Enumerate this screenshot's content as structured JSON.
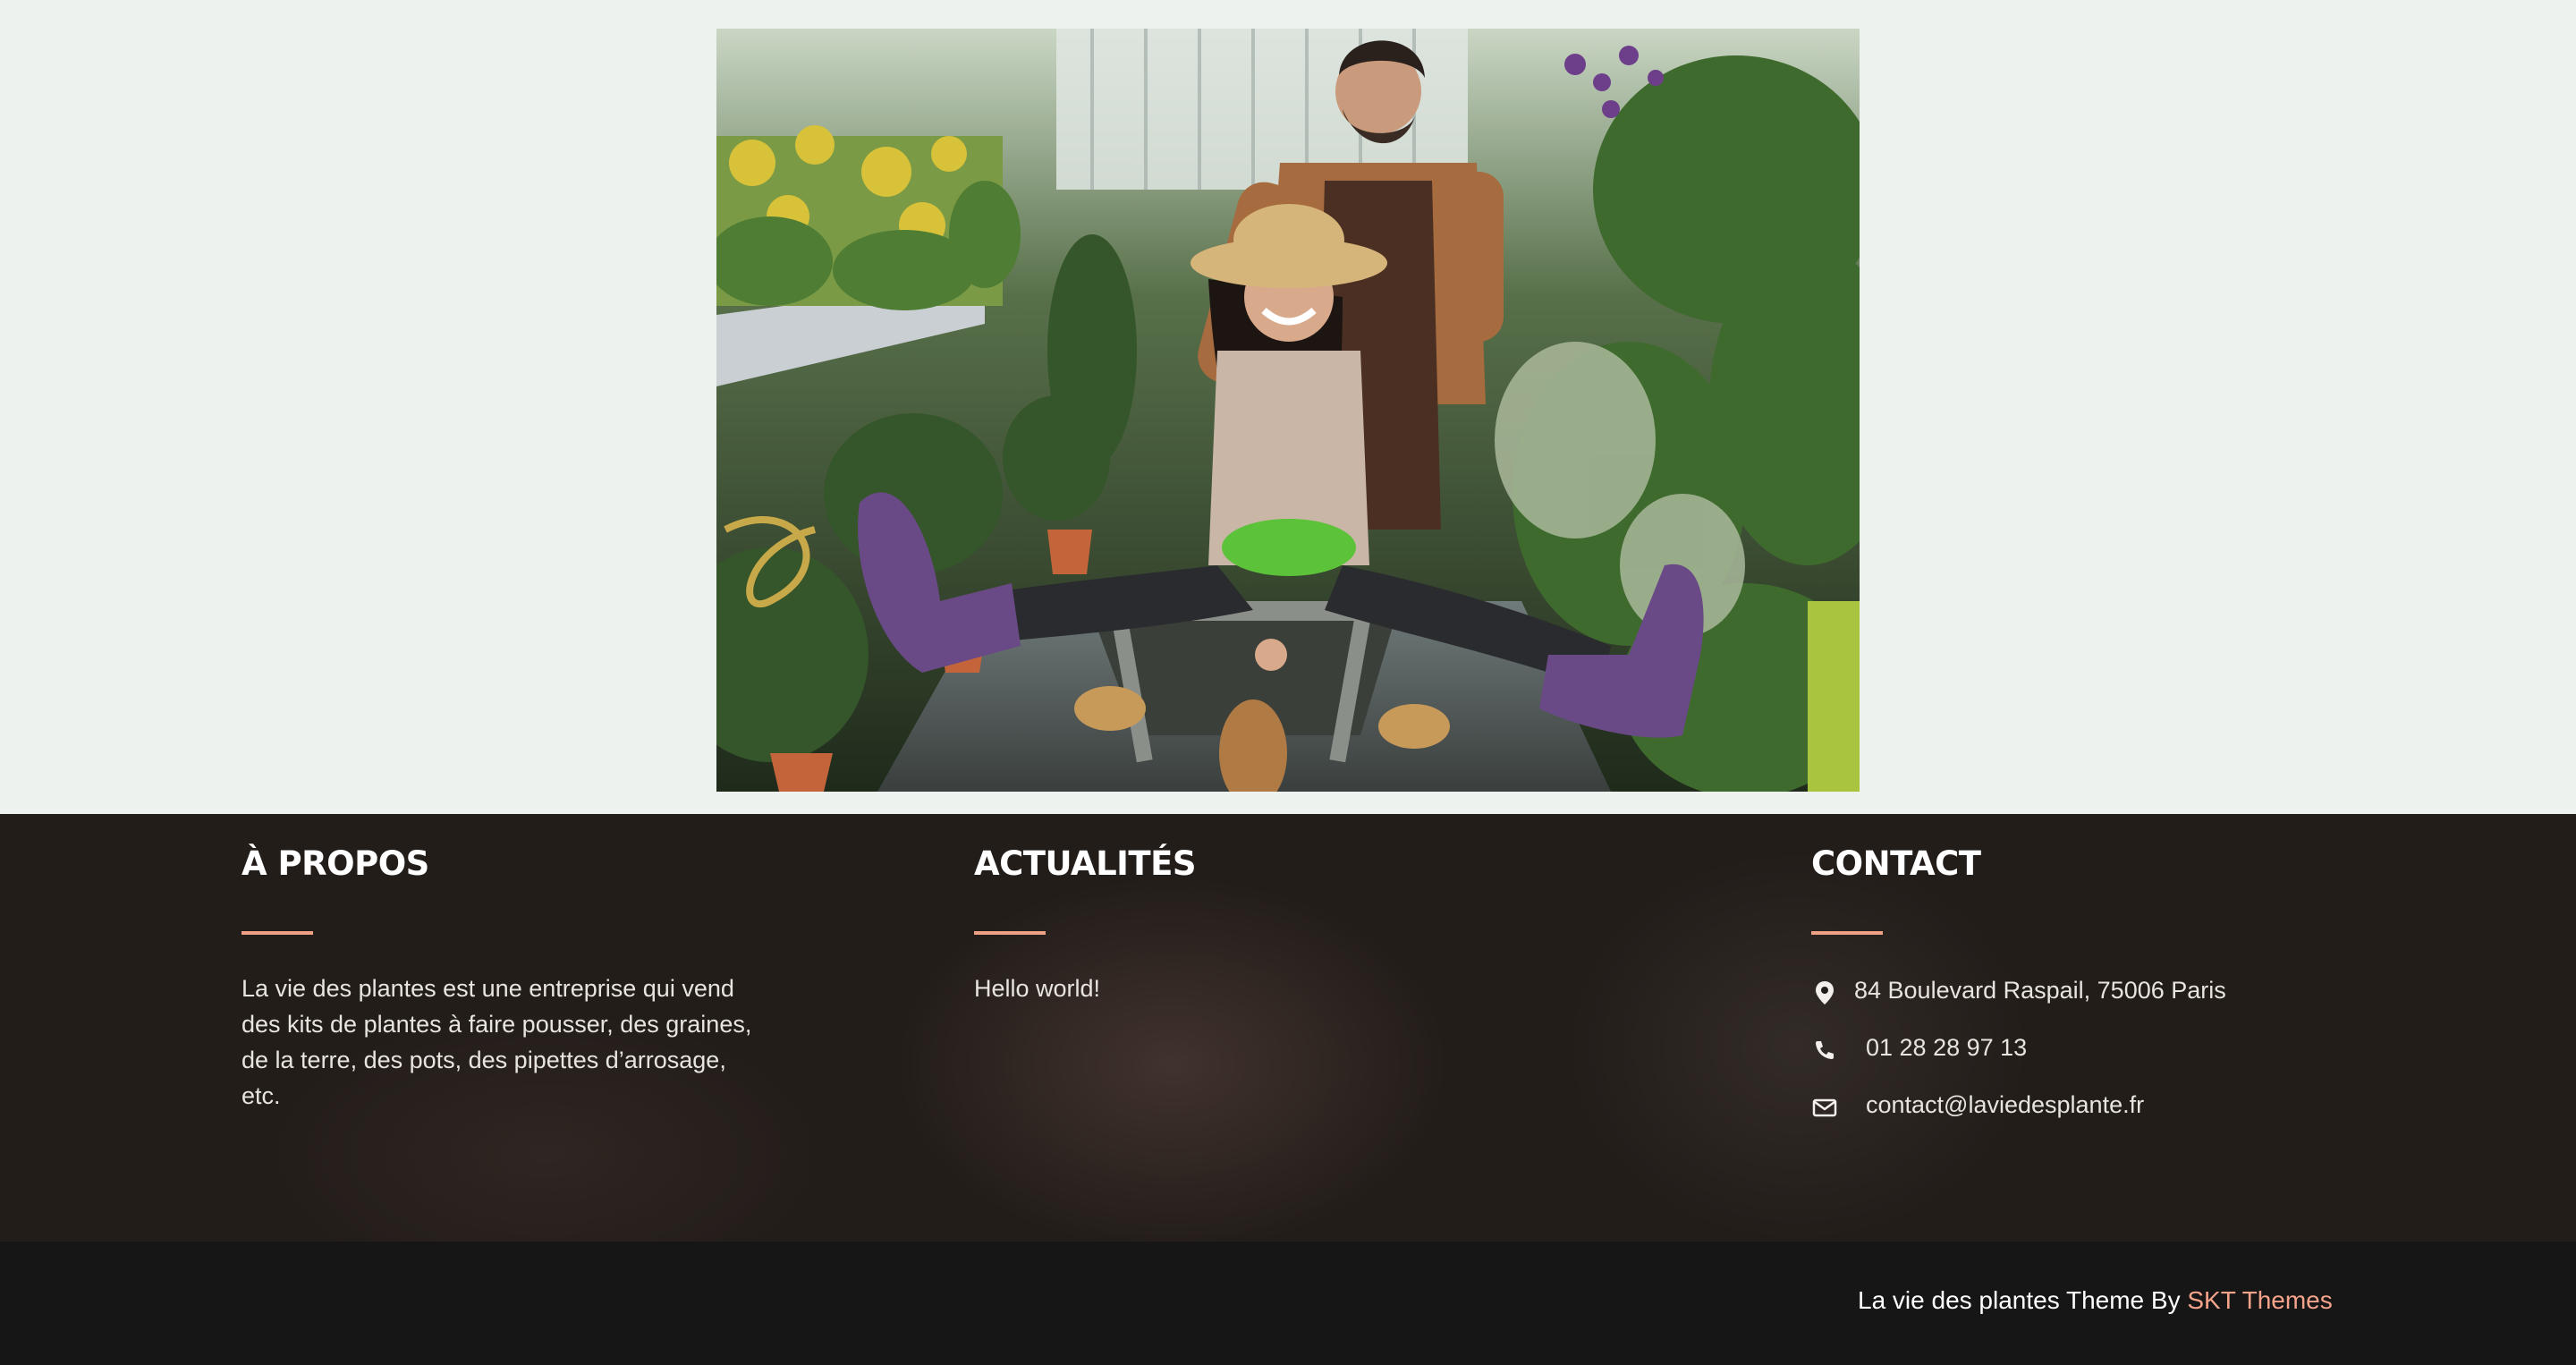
{
  "hero": {
    "image_description_icon": "garden-center-photo"
  },
  "footer": {
    "about": {
      "title": "À PROPOS",
      "text": "La vie des plantes est une entreprise qui vend des kits de plantes à faire pousser, des graines, de la terre, des pots, des pipettes d’arrosage, etc."
    },
    "news": {
      "title": "ACTUALITÉS",
      "items": [
        "Hello world!"
      ]
    },
    "contact": {
      "title": "CONTACT",
      "address": "84 Boulevard Raspail, 75006 Paris",
      "address_icon": "map-pin-icon",
      "phone": "01 28 28 97 13",
      "phone_icon": "phone-icon",
      "email": "contact@laviedesplante.fr",
      "email_icon": "envelope-icon"
    },
    "accent_color": "#f0a084"
  },
  "bottom_bar": {
    "credit_prefix": "La vie des plantes Theme By",
    "credit_link": "SKT Themes",
    "link_color": "#f5a38a"
  }
}
